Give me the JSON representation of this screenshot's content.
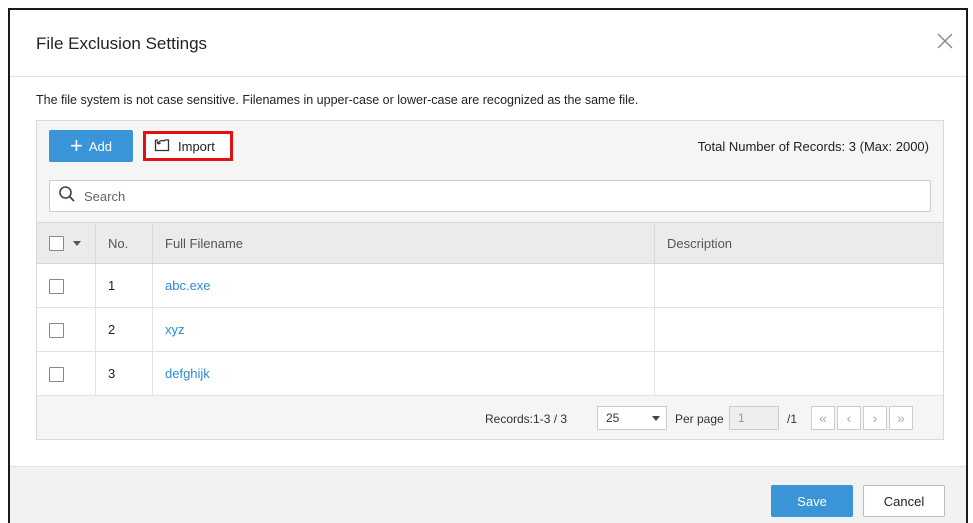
{
  "dialog": {
    "title": "File Exclusion Settings",
    "notice": "The file system is not case sensitive. Filenames in upper-case or lower-case are recognized as the same file."
  },
  "toolbar": {
    "add_label": "Add",
    "import_label": "Import",
    "total_records": "Total Number of Records: 3 (Max: 2000)"
  },
  "search": {
    "placeholder": "Search",
    "value": ""
  },
  "table": {
    "headers": [
      "No.",
      "Full Filename",
      "Description"
    ],
    "rows": [
      {
        "no": "1",
        "filename": "abc.exe",
        "description": ""
      },
      {
        "no": "2",
        "filename": "xyz",
        "description": ""
      },
      {
        "no": "3",
        "filename": "defghijk",
        "description": ""
      }
    ]
  },
  "pagination": {
    "records": "Records:1-3 / 3",
    "per_page_value": "25",
    "per_page_label": "Per page",
    "page_value": "1",
    "page_total": "/1"
  },
  "footer": {
    "save_label": "Save",
    "cancel_label": "Cancel"
  },
  "colors": {
    "accent": "#3a95d8",
    "link": "#2c8ad8",
    "highlight": "#e21010"
  },
  "icons": [
    "close-icon",
    "plus-icon",
    "import-icon",
    "search-icon",
    "chevron-down-icon",
    "first-page-icon",
    "prev-page-icon",
    "next-page-icon",
    "last-page-icon"
  ]
}
